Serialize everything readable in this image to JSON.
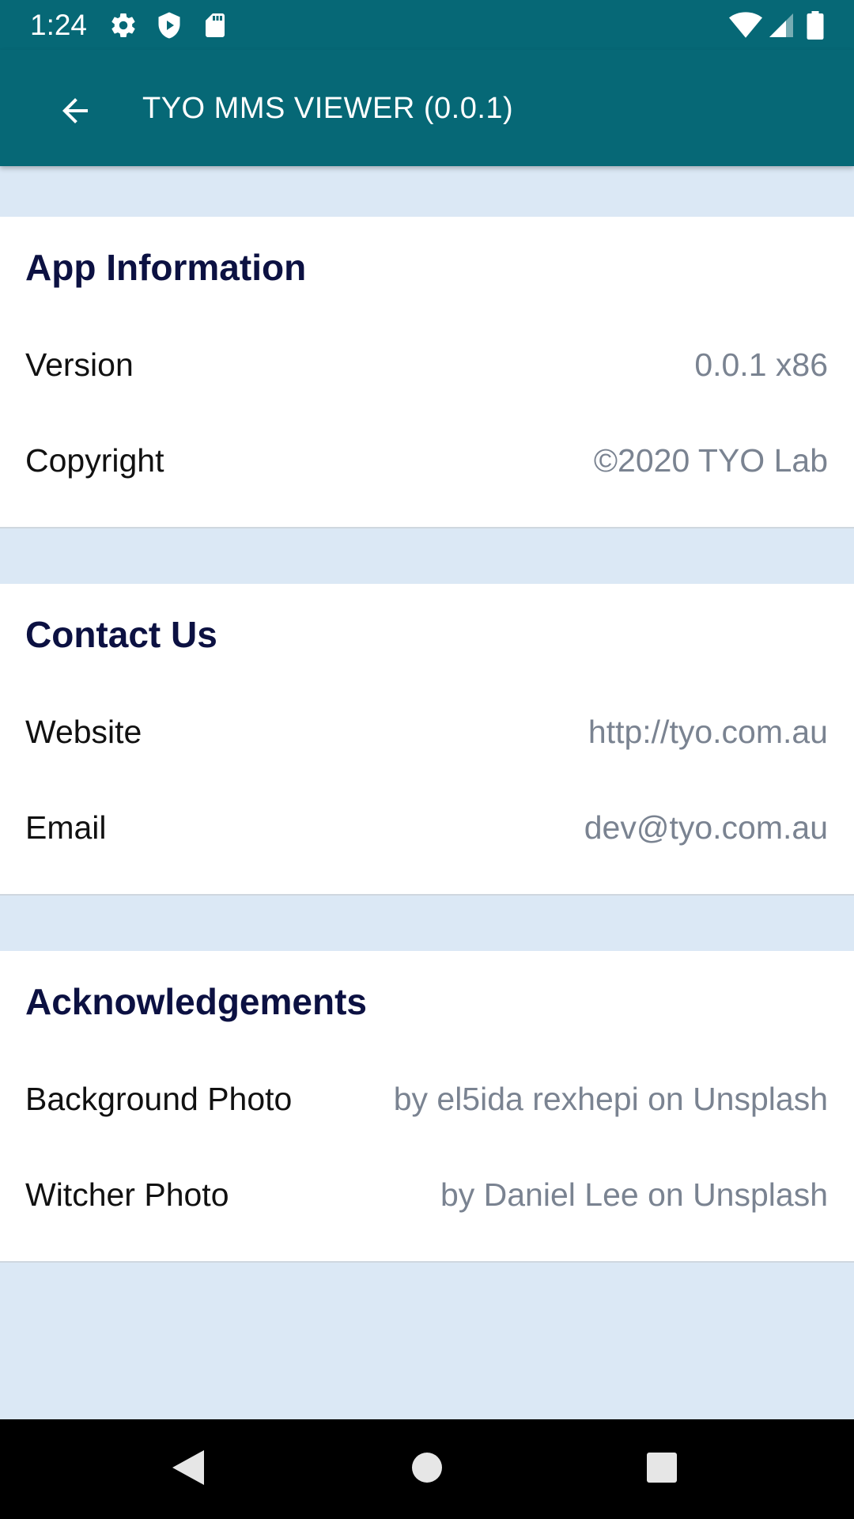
{
  "status_bar": {
    "time": "1:24",
    "left_icons": [
      "gear-icon",
      "shield-icon",
      "sd-card-icon"
    ],
    "right_icons": [
      "wifi-icon",
      "cell-signal-icon",
      "battery-icon"
    ]
  },
  "app_bar": {
    "title": "TYO MMS VIEWER (0.0.1)",
    "back_icon": "arrow-back-icon"
  },
  "sections": {
    "app_info": {
      "title": "App Information",
      "rows": [
        {
          "label": "Version",
          "value": "0.0.1 x86"
        },
        {
          "label": "Copyright",
          "value": "©2020 TYO Lab"
        }
      ]
    },
    "contact": {
      "title": "Contact Us",
      "rows": [
        {
          "label": "Website",
          "value": "http://tyo.com.au"
        },
        {
          "label": "Email",
          "value": "dev@tyo.com.au"
        }
      ]
    },
    "acknowledgements": {
      "title": "Acknowledgements",
      "rows": [
        {
          "label": "Background Photo",
          "value": "by el5ida rexhepi on Unsplash"
        },
        {
          "label": "Witcher Photo",
          "value": "by Daniel Lee on Unsplash"
        }
      ]
    }
  },
  "nav_bar": {
    "buttons": [
      "back-triangle-icon",
      "home-circle-icon",
      "recents-square-icon"
    ]
  },
  "colors": {
    "primary": "#066876",
    "background": "#dbe8f5",
    "section_title": "#0c1142",
    "value_text": "#7a8391"
  }
}
